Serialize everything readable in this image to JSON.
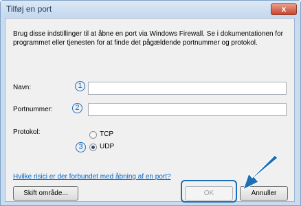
{
  "window": {
    "title": "Tilføj en port",
    "close_glyph": "x"
  },
  "intro_text": "Brug disse indstillinger til at åbne en port via Windows Firewall. Se i dokumentationen for programmet eller tjenesten for at finde det pågældende portnummer og protokol.",
  "form": {
    "name": {
      "label": "Navn:",
      "value": "",
      "marker": "1"
    },
    "port": {
      "label": "Portnummer:",
      "value": "",
      "marker": "2"
    },
    "protocol": {
      "label": "Protokol:",
      "marker": "3",
      "options": [
        {
          "label": "TCP",
          "selected": false
        },
        {
          "label": "UDP",
          "selected": true
        }
      ]
    }
  },
  "help_link": "Hvilke risici er der forbundet med åbning af en port?",
  "buttons": {
    "change_scope": "Skift område...",
    "ok": "OK",
    "cancel": "Annuller"
  },
  "colors": {
    "annotation_blue": "#1c6fb4",
    "link": "#0066cc"
  },
  "icons": {
    "annotation_arrow": "arrow-pointing-to-ok"
  }
}
